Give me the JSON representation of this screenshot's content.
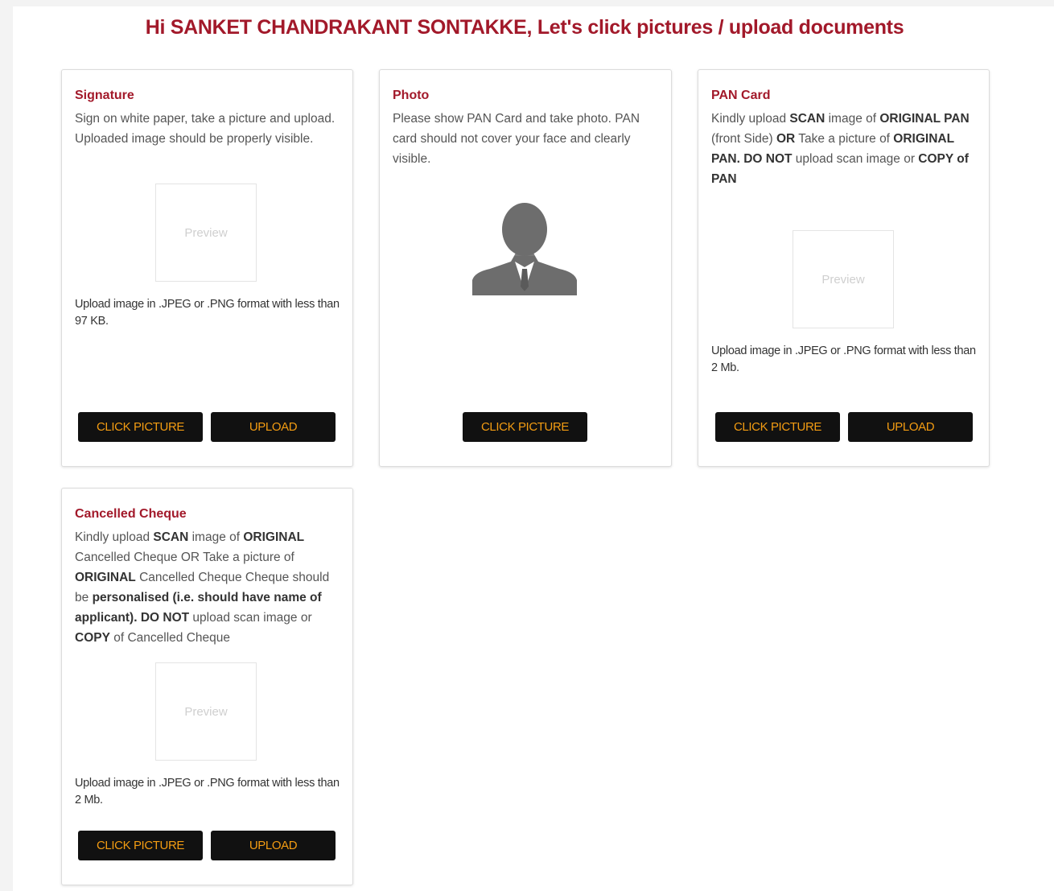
{
  "heading": "Hi SANKET CHANDRAKANT SONTAKKE, Let's click pictures / upload documents",
  "colors": {
    "accent": "#a2192a",
    "button_bg": "#111111",
    "button_text": "#f39c12"
  },
  "cards": {
    "signature": {
      "title": "Signature",
      "desc": [
        {
          "t": "Sign on white paper, take a picture and upload. Uploaded image should be properly visible.",
          "b": false
        }
      ],
      "preview": "Preview",
      "note": "Upload image in .JPEG or .PNG format with less than 97 KB.",
      "click_label": "CLICK PICTURE",
      "upload_label": "UPLOAD"
    },
    "photo": {
      "title": "Photo",
      "desc": [
        {
          "t": "Please show PAN Card and take photo. PAN card should not cover your face and clearly visible.",
          "b": false
        }
      ],
      "avatar_icon": "person-silhouette-icon",
      "click_label": "CLICK PICTURE"
    },
    "pan": {
      "title": "PAN Card",
      "desc": [
        {
          "t": "Kindly upload ",
          "b": false
        },
        {
          "t": "SCAN",
          "b": true
        },
        {
          "t": " image of ",
          "b": false
        },
        {
          "t": "ORIGINAL PAN",
          "b": true
        },
        {
          "t": " (front Side) ",
          "b": false
        },
        {
          "t": "OR",
          "b": true
        },
        {
          "t": " Take a picture of ",
          "b": false
        },
        {
          "t": "ORIGINAL PAN. DO NOT",
          "b": true
        },
        {
          "t": " upload scan image or ",
          "b": false
        },
        {
          "t": "COPY of PAN",
          "b": true
        }
      ],
      "preview": "Preview",
      "note": "Upload image in .JPEG or .PNG format with less than 2 Mb.",
      "click_label": "CLICK PICTURE",
      "upload_label": "UPLOAD"
    },
    "cheque": {
      "title": "Cancelled Cheque",
      "desc": [
        {
          "t": "Kindly upload ",
          "b": false
        },
        {
          "t": "SCAN",
          "b": true
        },
        {
          "t": " image of ",
          "b": false
        },
        {
          "t": "ORIGINAL",
          "b": true
        },
        {
          "t": " Cancelled Cheque OR Take a picture of ",
          "b": false
        },
        {
          "t": "ORIGINAL",
          "b": true
        },
        {
          "t": " Cancelled Cheque Cheque should be ",
          "b": false
        },
        {
          "t": "personalised (i.e. should have name of applicant). DO NOT",
          "b": true
        },
        {
          "t": " upload scan image or ",
          "b": false
        },
        {
          "t": "COPY",
          "b": true
        },
        {
          "t": " of Cancelled Cheque",
          "b": false
        }
      ],
      "preview": "Preview",
      "note": "Upload image in .JPEG or .PNG format with less than 2 Mb.",
      "click_label": "CLICK PICTURE",
      "upload_label": "UPLOAD"
    }
  }
}
